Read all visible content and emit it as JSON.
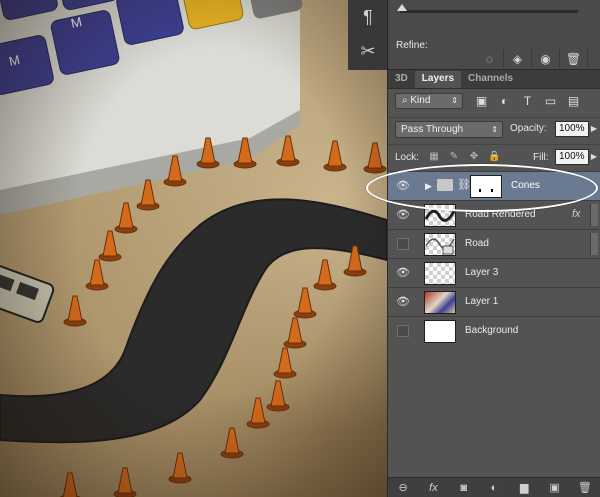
{
  "tool_strip": {
    "icons": [
      "paragraph-icon",
      "tools-icon"
    ],
    "glyphs": [
      "¶",
      "✂"
    ]
  },
  "properties_panel": {
    "refine_label": "Refine:",
    "icons": [
      "selection-icon",
      "mask-icon",
      "visibility-icon",
      "trash-icon"
    ],
    "glyphs": [
      "◌",
      "◈",
      "◉",
      "🗑"
    ]
  },
  "layers_panel": {
    "tabs": [
      "3D",
      "Layers",
      "Channels"
    ],
    "active_tab": "Layers",
    "filter_kind": "Kind",
    "filter_icons": [
      "image-filter-icon",
      "adjustment-filter-icon",
      "type-filter-icon",
      "shape-filter-icon",
      "smart-object-filter-icon"
    ],
    "filter_glyphs": [
      "▣",
      "◐",
      "T",
      "▭",
      "▤"
    ],
    "blend_mode": "Pass Through",
    "opacity_label": "Opacity:",
    "opacity_value": "100%",
    "lock_label": "Lock:",
    "fill_label": "Fill:",
    "fill_value": "100%",
    "layers": [
      {
        "name": "Cones",
        "type": "group",
        "visible": true,
        "selected": true
      },
      {
        "name": "Road Rendered",
        "type": "smart",
        "visible": true,
        "fx": "fx"
      },
      {
        "name": "Road",
        "type": "smart",
        "visible": false
      },
      {
        "name": "Layer 3",
        "type": "pixel",
        "visible": true
      },
      {
        "name": "Layer 1",
        "type": "photo",
        "visible": true
      },
      {
        "name": "Background",
        "type": "background",
        "visible": false
      }
    ],
    "bottom_icons": [
      "link-icon",
      "fx-icon",
      "add-mask-icon",
      "adjustment-icon",
      "new-group-icon",
      "new-layer-icon",
      "delete-layer-icon"
    ],
    "bottom_glyphs": [
      "⊖",
      "fx",
      "◙",
      "◐",
      "▆",
      "▣",
      "🗑"
    ]
  },
  "colors": {
    "accent_highlight": "#ffffff",
    "selected_row": "#6a7a90",
    "panel_bg": "#535353"
  }
}
